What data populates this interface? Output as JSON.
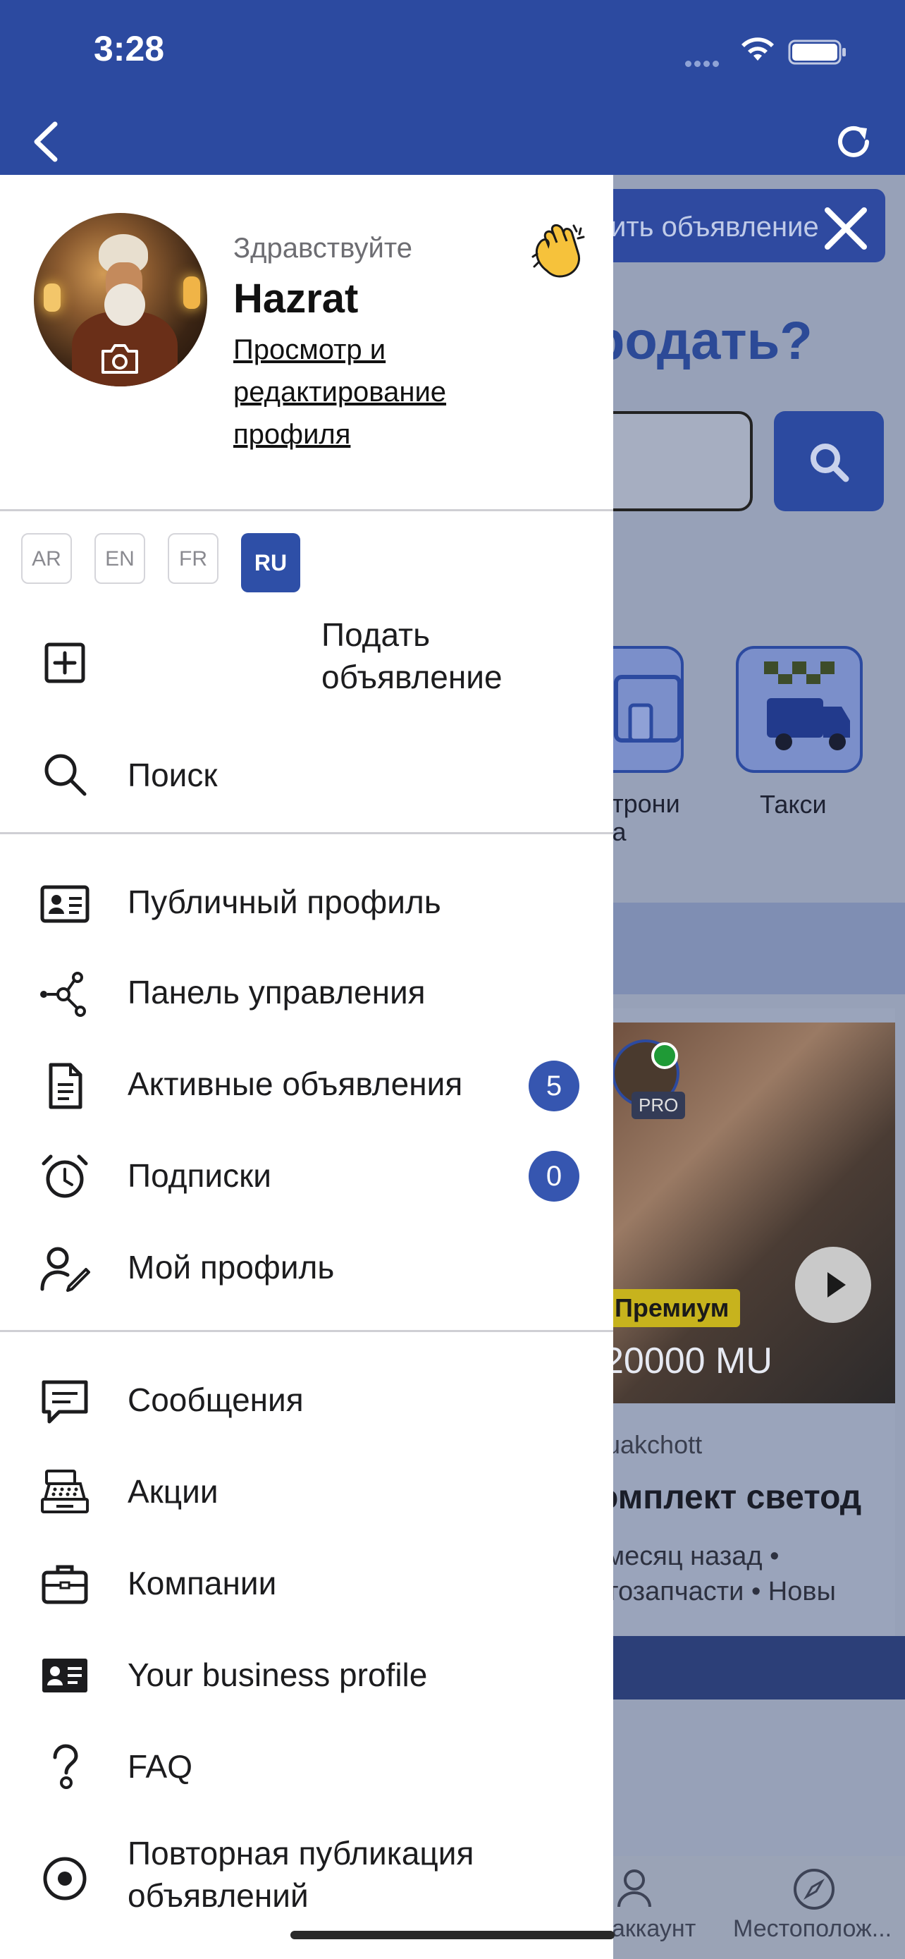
{
  "status_bar": {
    "time": "3:28"
  },
  "background": {
    "post_button_label": "ить объявление",
    "heading": "родать?",
    "categories": [
      {
        "label": "ктрони\nка"
      },
      {
        "label": "Такси"
      }
    ],
    "card": {
      "badge_premium": "Премиум",
      "badge_pro": "PRO",
      "price": "20000 MU",
      "city": "uakchott",
      "title": "омплект светод",
      "meta_line1": "месяц назад  •",
      "meta_line2": "тозапчасти  •  Новы"
    },
    "tabs": [
      {
        "label": "аккаунт"
      },
      {
        "label": "Местополож..."
      }
    ]
  },
  "drawer": {
    "greeting": "Здравствуйте",
    "user_name": "Hazrat",
    "profile_link": "Просмотр и редактирование профиля",
    "languages": [
      {
        "code": "AR",
        "active": false
      },
      {
        "code": "EN",
        "active": false
      },
      {
        "code": "FR",
        "active": false
      },
      {
        "code": "RU",
        "active": true
      }
    ],
    "section1": [
      {
        "label": "Подать\nобъявление",
        "icon": "plus-square-icon"
      },
      {
        "label": "Поиск",
        "icon": "search-icon"
      }
    ],
    "section2": [
      {
        "label": "Публичный профиль",
        "icon": "id-card-icon"
      },
      {
        "label": "Панель управления",
        "icon": "network-icon"
      },
      {
        "label": "Активные объявления",
        "icon": "document-icon",
        "count": "5"
      },
      {
        "label": "Подписки",
        "icon": "alarm-clock-icon",
        "count": "0"
      },
      {
        "label": "Мой профиль",
        "icon": "user-edit-icon"
      }
    ],
    "section3": [
      {
        "label": "Сообщения",
        "icon": "message-icon"
      },
      {
        "label": "Акции",
        "icon": "cash-register-icon"
      },
      {
        "label": "Компании",
        "icon": "briefcase-icon"
      },
      {
        "label": "Your business profile",
        "icon": "business-card-icon"
      },
      {
        "label": "FAQ",
        "icon": "question-icon"
      },
      {
        "label": "Повторная публикация\nобъявлений",
        "icon": "radio-target-icon"
      }
    ]
  }
}
